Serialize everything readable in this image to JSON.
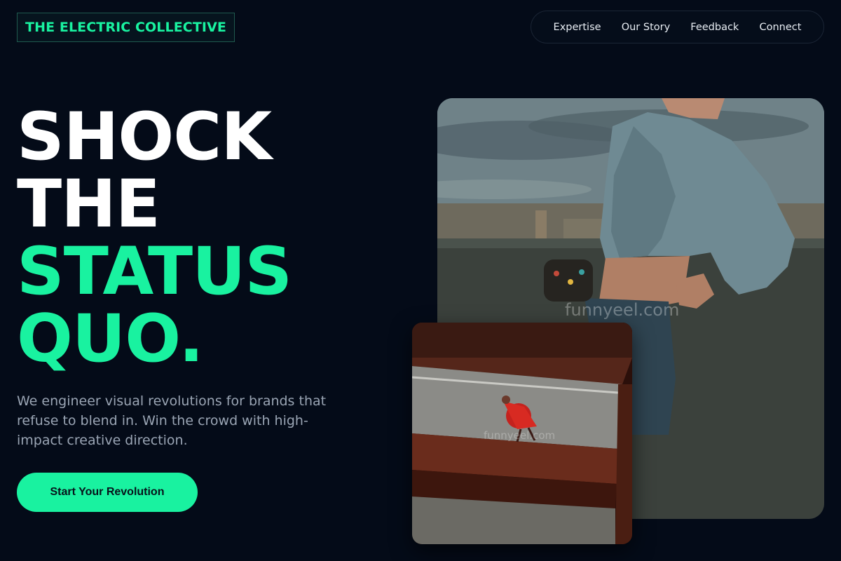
{
  "brand": {
    "logo_text": "THE ELECTRIC COLLECTIVE"
  },
  "nav": {
    "items": [
      {
        "label": "Expertise"
      },
      {
        "label": "Our Story"
      },
      {
        "label": "Feedback"
      },
      {
        "label": "Connect"
      }
    ]
  },
  "hero": {
    "headline": {
      "line1": "SHOCK",
      "line2": "THE",
      "line3": "STATUS",
      "line4": "QUO."
    },
    "subtitle": "We engineer visual revolutions for brands that refuse to blend in. Win the crowd with high-impact creative direction.",
    "cta_label": "Start Your Revolution"
  },
  "images": {
    "main_alt": "woman in denim jacket leaning on rooftop wall",
    "inset_alt": "person in red dress on stairs from above",
    "watermark_main": "funnyeel.com",
    "watermark_inset": "funnyeel.com"
  },
  "colors": {
    "background": "#040b18",
    "accent": "#19f2a0",
    "text_primary": "#ffffff",
    "text_muted": "#9aa5b4"
  }
}
